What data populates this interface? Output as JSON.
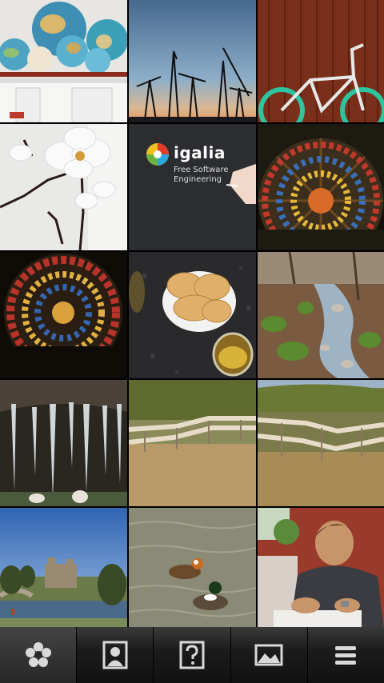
{
  "gallery": {
    "tiles": [
      {
        "subject": "globes-on-shelf"
      },
      {
        "subject": "cranes-at-dusk"
      },
      {
        "subject": "bicycle-against-wood"
      },
      {
        "subject": "white-orchid"
      },
      {
        "subject": "igalia-slide",
        "logo_text": "igalia",
        "tagline_1": "Free Software",
        "tagline_2": "Engineering"
      },
      {
        "subject": "rose-window"
      },
      {
        "subject": "rose-window-2"
      },
      {
        "subject": "pancakes-plate"
      },
      {
        "subject": "forest-stream"
      },
      {
        "subject": "ice-cave"
      },
      {
        "subject": "boardwalk-bridge"
      },
      {
        "subject": "boardwalk-bridge-2"
      },
      {
        "subject": "castle-and-river"
      },
      {
        "subject": "ducks-on-water"
      },
      {
        "subject": "man-writing"
      }
    ]
  },
  "toolbar": {
    "buttons": [
      {
        "icon": "flower-icon"
      },
      {
        "icon": "portrait-icon"
      },
      {
        "icon": "unknown-person-icon"
      },
      {
        "icon": "landscape-icon"
      },
      {
        "icon": "menu-icon"
      }
    ]
  },
  "colors": {
    "toolbar_bg": "#1c1c1c",
    "icon": "#d9d9d9"
  }
}
